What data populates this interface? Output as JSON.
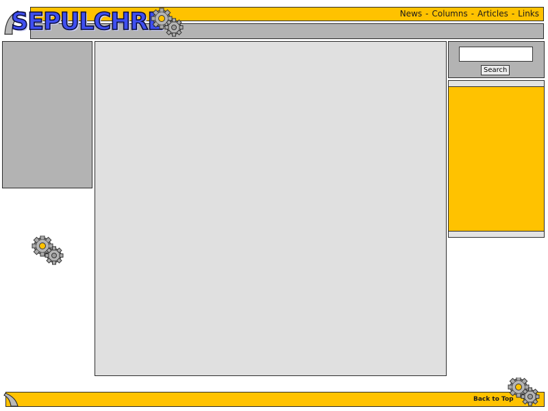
{
  "brand": {
    "name": "SEPULCHRE",
    "text_color": "#3f4ff0",
    "outline_color": "#0b0d3c"
  },
  "header": {
    "nav": [
      {
        "label": "News"
      },
      {
        "label": "Columns"
      },
      {
        "label": "Articles"
      },
      {
        "label": "Links"
      }
    ],
    "separator": "-"
  },
  "search": {
    "value": "",
    "button_label": "Search"
  },
  "footer": {
    "back_to_top_label": "Back to Top"
  },
  "icons": {
    "logo_gears": "gears-icon",
    "side_gears": "gears-icon",
    "footer_gears": "gears-icon"
  },
  "colors": {
    "accent_yellow": "#ffc200",
    "panel_gray": "#b3b3b3",
    "content_gray": "#e0e0e0",
    "gear_center": "#ffc200"
  }
}
